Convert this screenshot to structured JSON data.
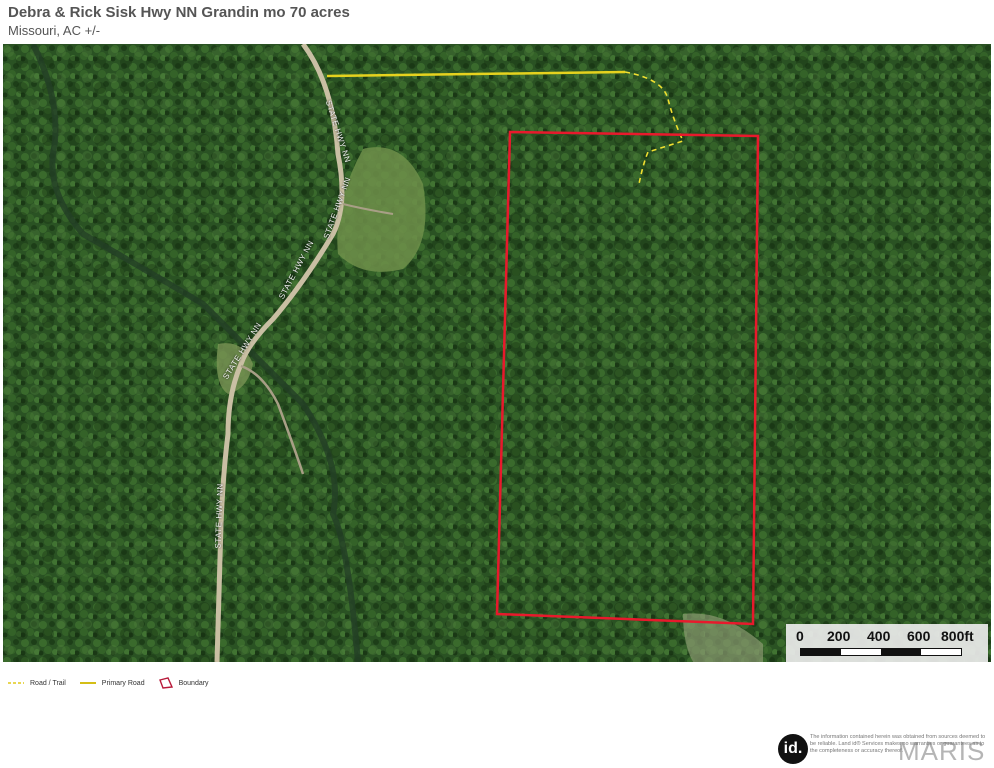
{
  "header": {
    "title": "Debra & Rick Sisk Hwy NN Grandin mo 70 acres",
    "subtitle": "Missouri,  AC +/-"
  },
  "map": {
    "road_labels": [
      "STATE HWY NN",
      "STATE HWY NN",
      "STATE HWY NN",
      "STATE HWY NN",
      "STATE HWY NN"
    ],
    "boundary_color": "#e8192c",
    "primary_road_color": "#e6d21e",
    "trail_color": "#f0e030",
    "scalebar": {
      "labels": [
        "0",
        "200",
        "400",
        "600",
        "800ft"
      ]
    }
  },
  "legend": {
    "items": [
      {
        "label": "Road / Trail",
        "icon": "dashed-line-icon"
      },
      {
        "label": "Primary Road",
        "icon": "solid-line-icon"
      },
      {
        "label": "Boundary",
        "icon": "polygon-outline-icon"
      }
    ]
  },
  "footer": {
    "logo_text": "id.",
    "disclaimer": "The information contained herein was obtained from sources deemed to be reliable. Land id® Services makes no warranties or guarantees as to the completeness or accuracy thereof.",
    "watermark": "MARIS"
  }
}
